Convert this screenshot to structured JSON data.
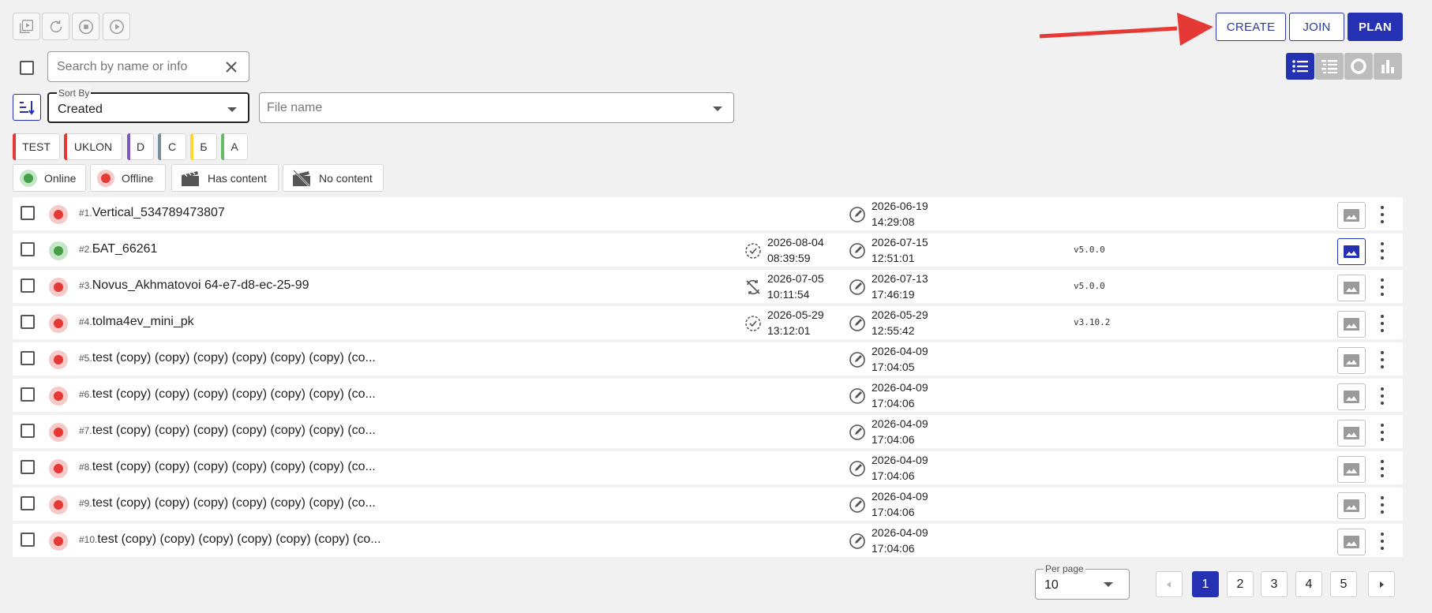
{
  "toolbar": {
    "icons": [
      "play-library-icon",
      "refresh-icon",
      "stop-icon",
      "play-icon"
    ]
  },
  "header": {
    "create_label": "CREATE",
    "join_label": "JOIN",
    "plan_label": "PLAN"
  },
  "search": {
    "placeholder": "Search by name or info"
  },
  "sort": {
    "label": "Sort By",
    "value": "Created"
  },
  "file_filter": {
    "placeholder": "File name"
  },
  "tags": [
    {
      "label": "TEST",
      "color": "#e53935"
    },
    {
      "label": "UKLON",
      "color": "#e53935"
    },
    {
      "label": "D",
      "color": "#7e57c2"
    },
    {
      "label": "C",
      "color": "#78909c"
    },
    {
      "label": "Б",
      "color": "#fdd835"
    },
    {
      "label": "A",
      "color": "#66bb6a"
    }
  ],
  "filters": {
    "online": "Online",
    "offline": "Offline",
    "has_content": "Has content",
    "no_content": "No content"
  },
  "colors": {
    "accent": "#2431b3",
    "online": "#43a047",
    "offline": "#e53935",
    "annotation_arrow": "#e53935"
  },
  "rows": [
    {
      "num": "#1.",
      "name": "Vertical_534789473807",
      "status": "offline",
      "sync_date": "",
      "sync_time": "",
      "sync_icon": "",
      "edit_date": "2026-06-19",
      "edit_time": "14:29:08",
      "version": "",
      "thumb_active": false
    },
    {
      "num": "#2.",
      "name": "БАТ_66261",
      "status": "online",
      "sync_date": "2026-08-04",
      "sync_time": "08:39:59",
      "sync_icon": "sync-ok-icon",
      "edit_date": "2026-07-15",
      "edit_time": "12:51:01",
      "version": "v5.0.0",
      "thumb_active": true
    },
    {
      "num": "#3.",
      "name": "Novus_Akhmatovoi 64-e7-d8-ec-25-99",
      "status": "offline",
      "sync_date": "2026-07-05",
      "sync_time": "10:11:54",
      "sync_icon": "sync-off-icon",
      "edit_date": "2026-07-13",
      "edit_time": "17:46:19",
      "version": "v5.0.0",
      "thumb_active": false
    },
    {
      "num": "#4.",
      "name": "tolma4ev_mini_pk",
      "status": "offline",
      "sync_date": "2026-05-29",
      "sync_time": "13:12:01",
      "sync_icon": "sync-ok-icon",
      "edit_date": "2026-05-29",
      "edit_time": "12:55:42",
      "version": "v3.10.2",
      "thumb_active": false
    },
    {
      "num": "#5.",
      "name": "test (copy) (copy) (copy) (copy) (copy) (copy) (co...",
      "status": "offline",
      "sync_date": "",
      "sync_time": "",
      "sync_icon": "",
      "edit_date": "2026-04-09",
      "edit_time": "17:04:05",
      "version": "",
      "thumb_active": false
    },
    {
      "num": "#6.",
      "name": "test (copy) (copy) (copy) (copy) (copy) (copy) (co...",
      "status": "offline",
      "sync_date": "",
      "sync_time": "",
      "sync_icon": "",
      "edit_date": "2026-04-09",
      "edit_time": "17:04:06",
      "version": "",
      "thumb_active": false
    },
    {
      "num": "#7.",
      "name": "test (copy) (copy) (copy) (copy) (copy) (copy) (co...",
      "status": "offline",
      "sync_date": "",
      "sync_time": "",
      "sync_icon": "",
      "edit_date": "2026-04-09",
      "edit_time": "17:04:06",
      "version": "",
      "thumb_active": false
    },
    {
      "num": "#8.",
      "name": "test (copy) (copy) (copy) (copy) (copy) (copy) (co...",
      "status": "offline",
      "sync_date": "",
      "sync_time": "",
      "sync_icon": "",
      "edit_date": "2026-04-09",
      "edit_time": "17:04:06",
      "version": "",
      "thumb_active": false
    },
    {
      "num": "#9.",
      "name": "test (copy) (copy) (copy) (copy) (copy) (copy) (co...",
      "status": "offline",
      "sync_date": "",
      "sync_time": "",
      "sync_icon": "",
      "edit_date": "2026-04-09",
      "edit_time": "17:04:06",
      "version": "",
      "thumb_active": false
    },
    {
      "num": "#10.",
      "name": "test (copy) (copy) (copy) (copy) (copy) (copy) (co...",
      "status": "offline",
      "sync_date": "",
      "sync_time": "",
      "sync_icon": "",
      "edit_date": "2026-04-09",
      "edit_time": "17:04:06",
      "version": "",
      "thumb_active": false
    }
  ],
  "pagination": {
    "per_page_label": "Per page",
    "per_page_value": "10",
    "pages": [
      "1",
      "2",
      "3",
      "4",
      "5"
    ],
    "current": "1"
  }
}
